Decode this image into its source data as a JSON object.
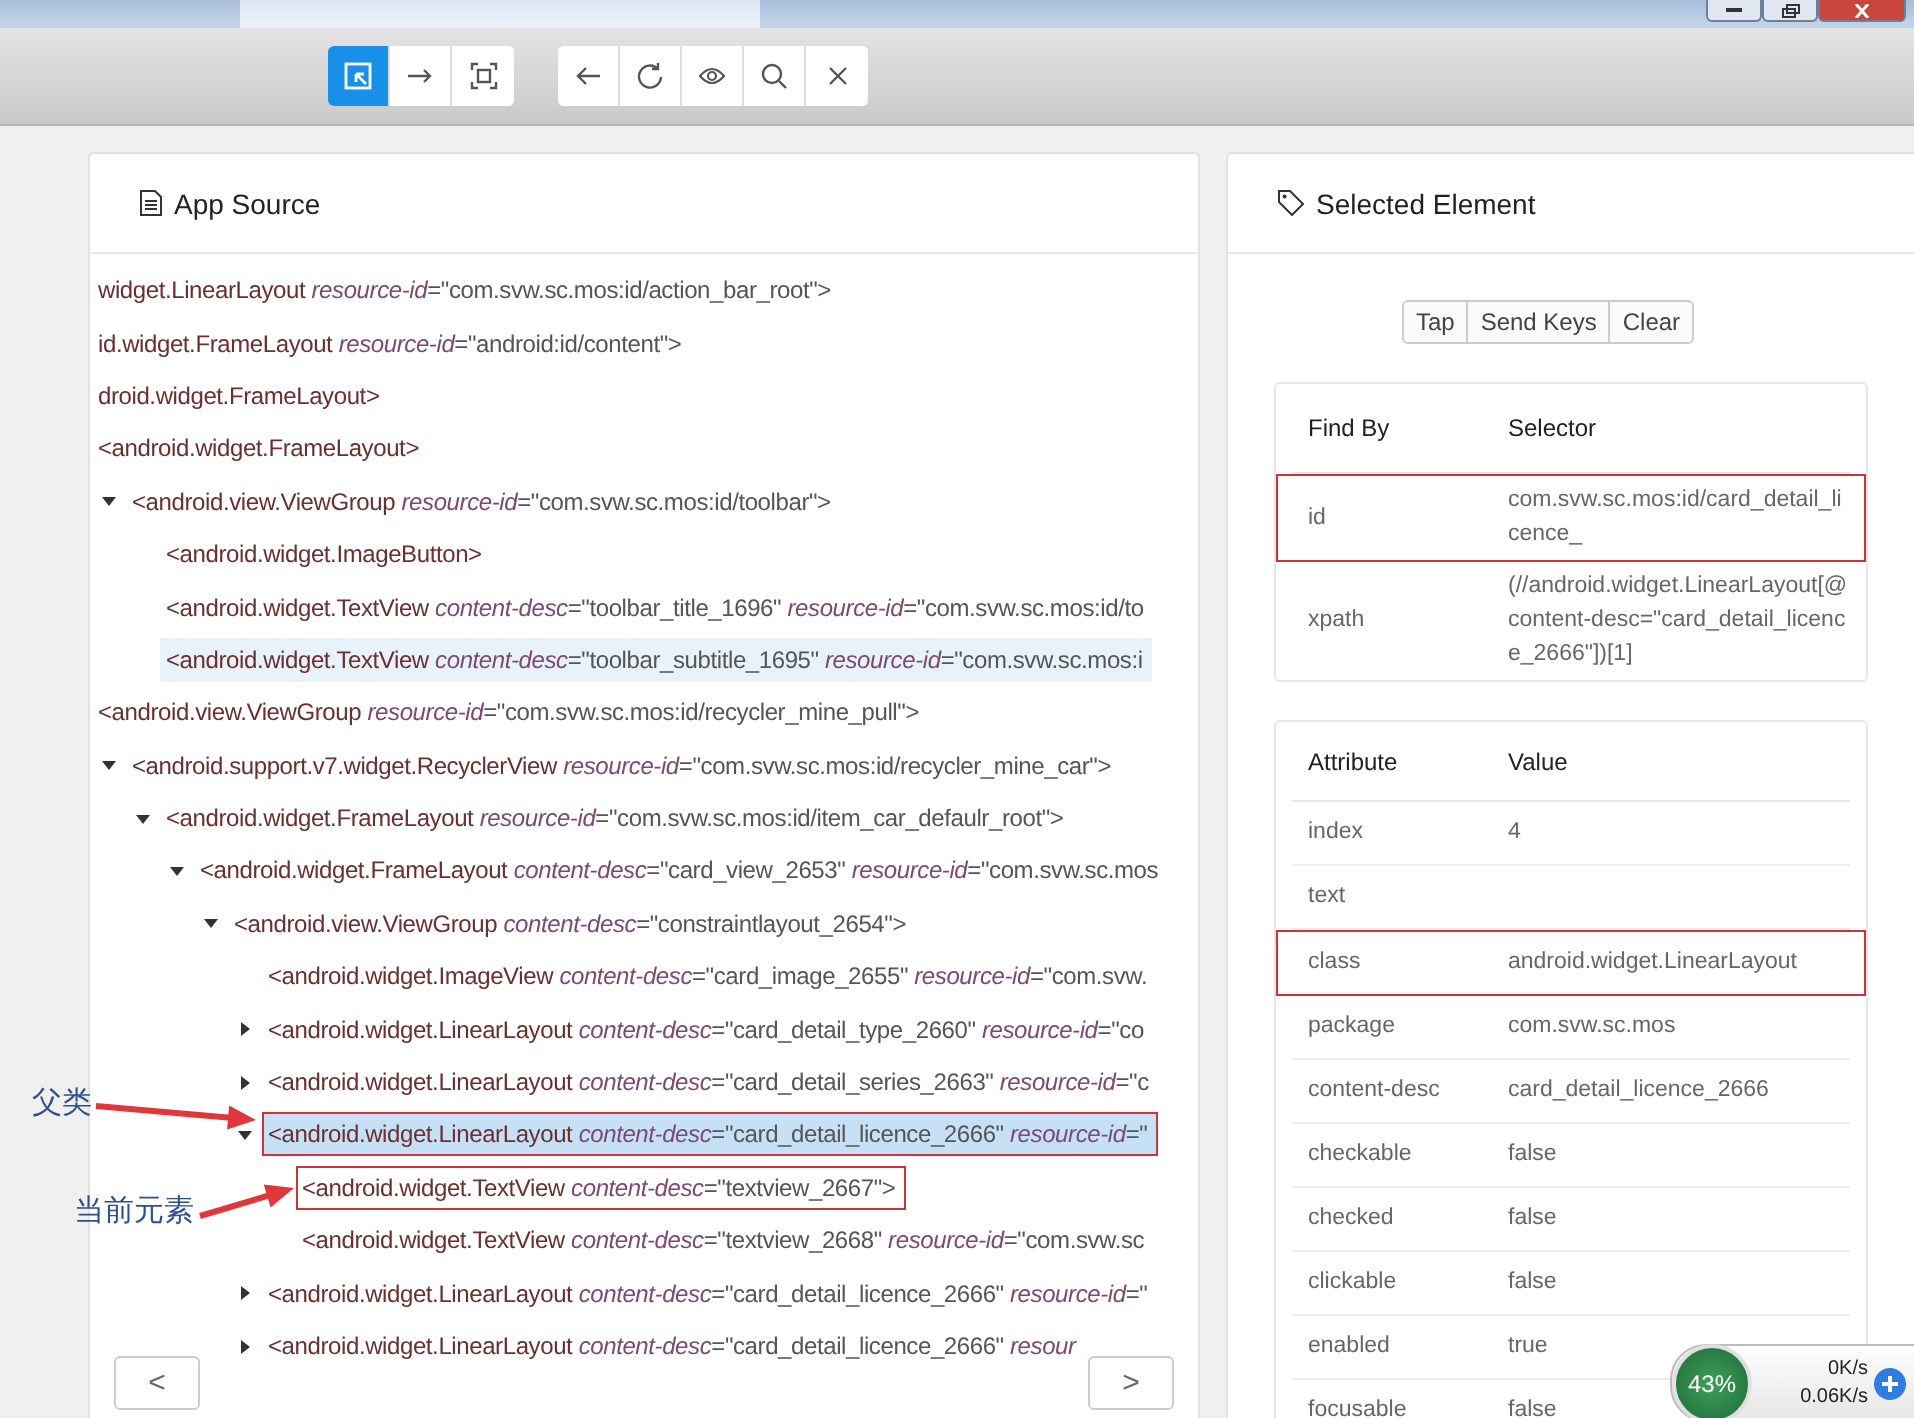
{
  "toolbar": {
    "groups": [
      [
        {
          "selected": true
        },
        {
          "selected": false
        },
        {
          "selected": false
        }
      ],
      [
        {
          "selected": false
        },
        {
          "selected": false
        },
        {
          "selected": false
        },
        {
          "selected": false
        },
        {
          "selected": false
        }
      ]
    ]
  },
  "source_panel": {
    "title": "App Source",
    "tree": [
      {
        "tag": "widget.LinearLayout",
        "attrs": [
          {
            "name": "resource-id",
            "rest": "=\"com.svw.sc.mos:id/action_bar_root\">"
          }
        ],
        "selected": false,
        "hovered": false,
        "boxed": false
      },
      {
        "tag": "id.widget.FrameLayout",
        "attrs": [
          {
            "name": "resource-id",
            "rest": "=\"android:id/content\">"
          }
        ],
        "selected": false,
        "hovered": false,
        "boxed": false
      },
      {
        "tag": "droid.widget.FrameLayout>",
        "selected": false,
        "hovered": false,
        "boxed": false
      },
      {
        "tag": "<android.widget.FrameLayout>",
        "selected": false,
        "hovered": false,
        "boxed": false
      },
      {
        "tag": "<android.view.ViewGroup",
        "attrs": [
          {
            "name": "resource-id",
            "rest": "=\"com.svw.sc.mos:id/toolbar\">"
          }
        ],
        "expanded": true,
        "selected": false,
        "hovered": false,
        "boxed": false,
        "children": [
          {
            "tag": "<android.widget.ImageButton>",
            "selected": false,
            "hovered": false,
            "boxed": false
          },
          {
            "tag": "<android.widget.TextView",
            "attrs": [
              {
                "name": "content-desc",
                "rest": "=\"toolbar_title_1696\""
              },
              {
                "name": "resource-id",
                "rest": "=\"com.svw.sc.mos:id/to"
              }
            ],
            "selected": false,
            "hovered": false,
            "boxed": false
          },
          {
            "tag": "<android.widget.TextView",
            "attrs": [
              {
                "name": "content-desc",
                "rest": "=\"toolbar_subtitle_1695\""
              },
              {
                "name": "resource-id",
                "rest": "=\"com.svw.sc.mos:i"
              }
            ],
            "selected": false,
            "hovered": true,
            "boxed": false
          }
        ]
      },
      {
        "tag": "<android.view.ViewGroup",
        "attrs": [
          {
            "name": "resource-id",
            "rest": "=\"com.svw.sc.mos:id/recycler_mine_pull\">"
          }
        ],
        "selected": false,
        "hovered": false,
        "boxed": false
      },
      {
        "tag": "<android.support.v7.widget.RecyclerView",
        "attrs": [
          {
            "name": "resource-id",
            "rest": "=\"com.svw.sc.mos:id/recycler_mine_car\">"
          }
        ],
        "expanded": true,
        "selected": false,
        "hovered": false,
        "boxed": false,
        "children": [
          {
            "tag": "<android.widget.FrameLayout",
            "attrs": [
              {
                "name": "resource-id",
                "rest": "=\"com.svw.sc.mos:id/item_car_defaulr_root\">"
              }
            ],
            "expanded": true,
            "selected": false,
            "hovered": false,
            "boxed": false,
            "children": [
              {
                "tag": "<android.widget.FrameLayout",
                "attrs": [
                  {
                    "name": "content-desc",
                    "rest": "=\"card_view_2653\""
                  },
                  {
                    "name": "resource-id",
                    "rest": "=\"com.svw.sc.mos"
                  }
                ],
                "expanded": true,
                "selected": false,
                "hovered": false,
                "boxed": false,
                "children": [
                  {
                    "tag": "<android.view.ViewGroup",
                    "attrs": [
                      {
                        "name": "content-desc",
                        "rest": "=\"constraintlayout_2654\">"
                      }
                    ],
                    "expanded": true,
                    "selected": false,
                    "hovered": false,
                    "boxed": false,
                    "children": [
                      {
                        "tag": "<android.widget.ImageView",
                        "attrs": [
                          {
                            "name": "content-desc",
                            "rest": "=\"card_image_2655\""
                          },
                          {
                            "name": "resource-id",
                            "rest": "=\"com.svw."
                          }
                        ],
                        "selected": false,
                        "hovered": false,
                        "boxed": false
                      },
                      {
                        "tag": "<android.widget.LinearLayout",
                        "attrs": [
                          {
                            "name": "content-desc",
                            "rest": "=\"card_detail_type_2660\""
                          },
                          {
                            "name": "resource-id",
                            "rest": "=\"co"
                          }
                        ],
                        "expanded": false,
                        "selected": false,
                        "hovered": false,
                        "boxed": false
                      },
                      {
                        "tag": "<android.widget.LinearLayout",
                        "attrs": [
                          {
                            "name": "content-desc",
                            "rest": "=\"card_detail_series_2663\""
                          },
                          {
                            "name": "resource-id",
                            "rest": "=\"c"
                          }
                        ],
                        "expanded": false,
                        "selected": false,
                        "hovered": false,
                        "boxed": false
                      },
                      {
                        "tag": "<android.widget.LinearLayout",
                        "attrs": [
                          {
                            "name": "content-desc",
                            "rest": "=\"card_detail_licence_2666\""
                          },
                          {
                            "name": "resource-id",
                            "rest": "=\""
                          }
                        ],
                        "expanded": true,
                        "selected": true,
                        "hovered": false,
                        "boxed": true,
                        "children": [
                          {
                            "tag": "<android.widget.TextView",
                            "attrs": [
                              {
                                "name": "content-desc",
                                "rest": "=\"textview_2667\">"
                              }
                            ],
                            "selected": false,
                            "hovered": false,
                            "boxed": true
                          },
                          {
                            "tag": "<android.widget.TextView",
                            "attrs": [
                              {
                                "name": "content-desc",
                                "rest": "=\"textview_2668\""
                              },
                              {
                                "name": "resource-id",
                                "rest": "=\"com.svw.sc"
                              }
                            ],
                            "selected": false,
                            "hovered": false,
                            "boxed": false
                          }
                        ]
                      },
                      {
                        "tag": "<android.widget.LinearLayout",
                        "attrs": [
                          {
                            "name": "content-desc",
                            "rest": "=\"card_detail_licence_2666\""
                          },
                          {
                            "name": "resource-id",
                            "rest": "=\""
                          }
                        ],
                        "expanded": false,
                        "selected": false,
                        "hovered": false,
                        "boxed": false
                      },
                      {
                        "tag": "<android.widget.LinearLayout",
                        "attrs": [
                          {
                            "name": "content-desc",
                            "rest": "=\"card_detail_licence_2666\""
                          },
                          {
                            "name": "resour"
                          }
                        ],
                        "expanded": false,
                        "selected": false,
                        "hovered": false,
                        "boxed": false
                      }
                    ]
                  }
                ]
              }
            ]
          }
        ]
      }
    ],
    "nav": [
      "<",
      ">"
    ]
  },
  "element_panel": {
    "title": "Selected Element",
    "actions": [
      "Tap",
      "Send Keys",
      "Clear"
    ],
    "find_by": {
      "columns": [
        "Find By",
        "Selector"
      ],
      "rows": [
        {
          "cells": [
            "id",
            "com.svw.sc.mos:id/card_detail_licence_"
          ],
          "boxed": true
        },
        {
          "cells": [
            "xpath",
            "(//android.widget.LinearLayout[@content-desc=\"card_detail_licence_2666\"])[1]"
          ],
          "boxed": false
        }
      ]
    },
    "attributes": {
      "columns": [
        "Attribute",
        "Value"
      ],
      "rows": [
        {
          "name": "index",
          "value": "4",
          "boxed": false
        },
        {
          "name": "text",
          "boxed": false
        },
        {
          "name": "class",
          "value": "android.widget.LinearLayout",
          "boxed": true
        },
        {
          "name": "package",
          "value": "com.svw.sc.mos",
          "boxed": false
        },
        {
          "name": "content-desc",
          "value": "card_detail_licence_2666",
          "boxed": false
        },
        {
          "name": "checkable",
          "value": "false",
          "boxed": false
        },
        {
          "name": "checked",
          "value": "false",
          "boxed": false
        },
        {
          "name": "clickable",
          "value": "false",
          "boxed": false
        },
        {
          "name": "enabled",
          "value": "true",
          "boxed": false
        },
        {
          "name": "focusable",
          "value": "false",
          "boxed": false
        }
      ]
    }
  },
  "annotations": [
    {
      "label": "父类"
    },
    {
      "label": "当前元素"
    }
  ],
  "network_monitor": {
    "percent": "43%",
    "upload": "0K/s",
    "download": "0.06K/s"
  }
}
